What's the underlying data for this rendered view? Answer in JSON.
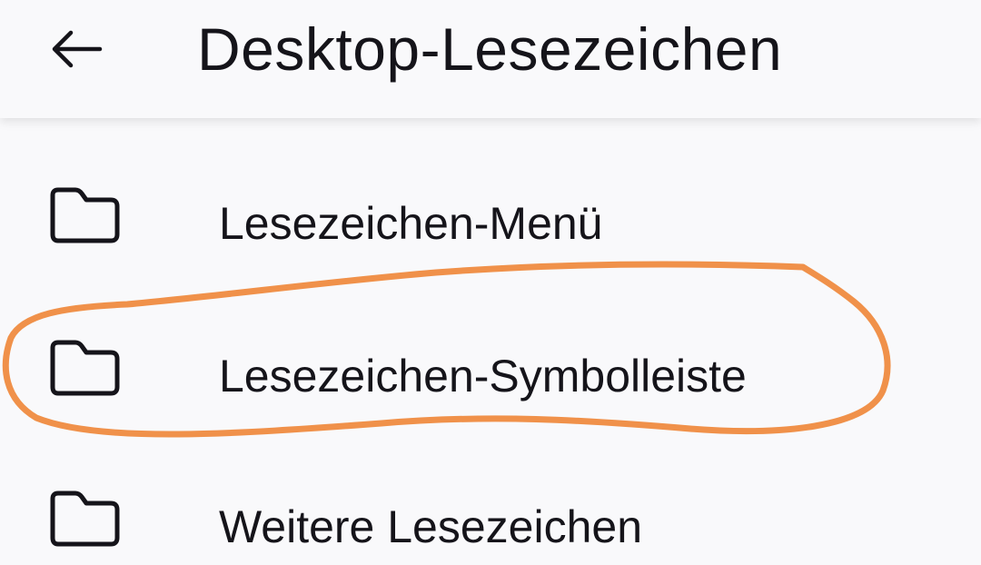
{
  "toolbar": {
    "back_icon": "arrow-left-icon",
    "title": "Desktop-Lesezeichen"
  },
  "folders": [
    {
      "label": "Lesezeichen-Menü",
      "icon": "folder-icon"
    },
    {
      "label": "Lesezeichen-Symbolleiste",
      "icon": "folder-icon"
    },
    {
      "label": "Weitere Lesezeichen",
      "icon": "folder-icon"
    }
  ],
  "annotation": {
    "color": "#f0914a",
    "target": "Lesezeichen-Symbolleiste"
  },
  "colors": {
    "background": "#f9f9fb",
    "text": "#15141a"
  }
}
